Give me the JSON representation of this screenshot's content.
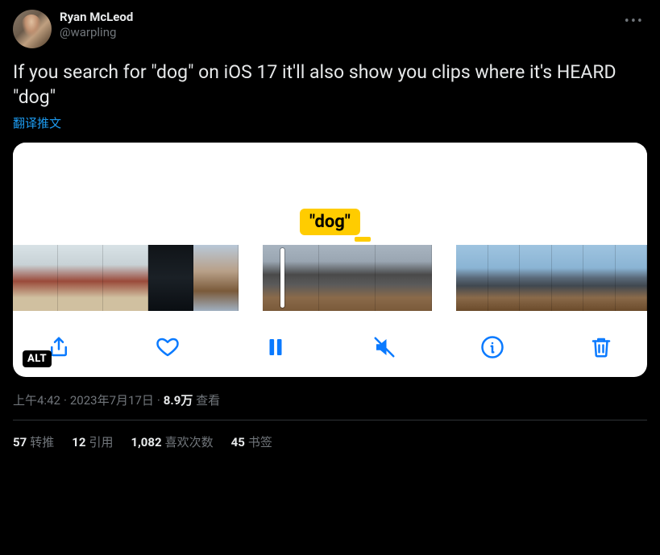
{
  "user": {
    "display_name": "Ryan McLeod",
    "handle": "@warpling"
  },
  "tweet_text": "If you search for \"dog\" on iOS 17 it'll also show you clips where it's HEARD \"dog\"",
  "translate_label": "翻译推文",
  "media": {
    "badge_text": "\"dog\"",
    "alt_label": "ALT"
  },
  "meta": {
    "time": "上午4:42",
    "date": "2023年7月17日",
    "views_count": "8.9万",
    "views_label": "查看"
  },
  "stats": {
    "retweets_count": "57",
    "retweets_label": "转推",
    "quotes_count": "12",
    "quotes_label": "引用",
    "likes_count": "1,082",
    "likes_label": "喜欢次数",
    "bookmarks_count": "45",
    "bookmarks_label": "书签"
  }
}
